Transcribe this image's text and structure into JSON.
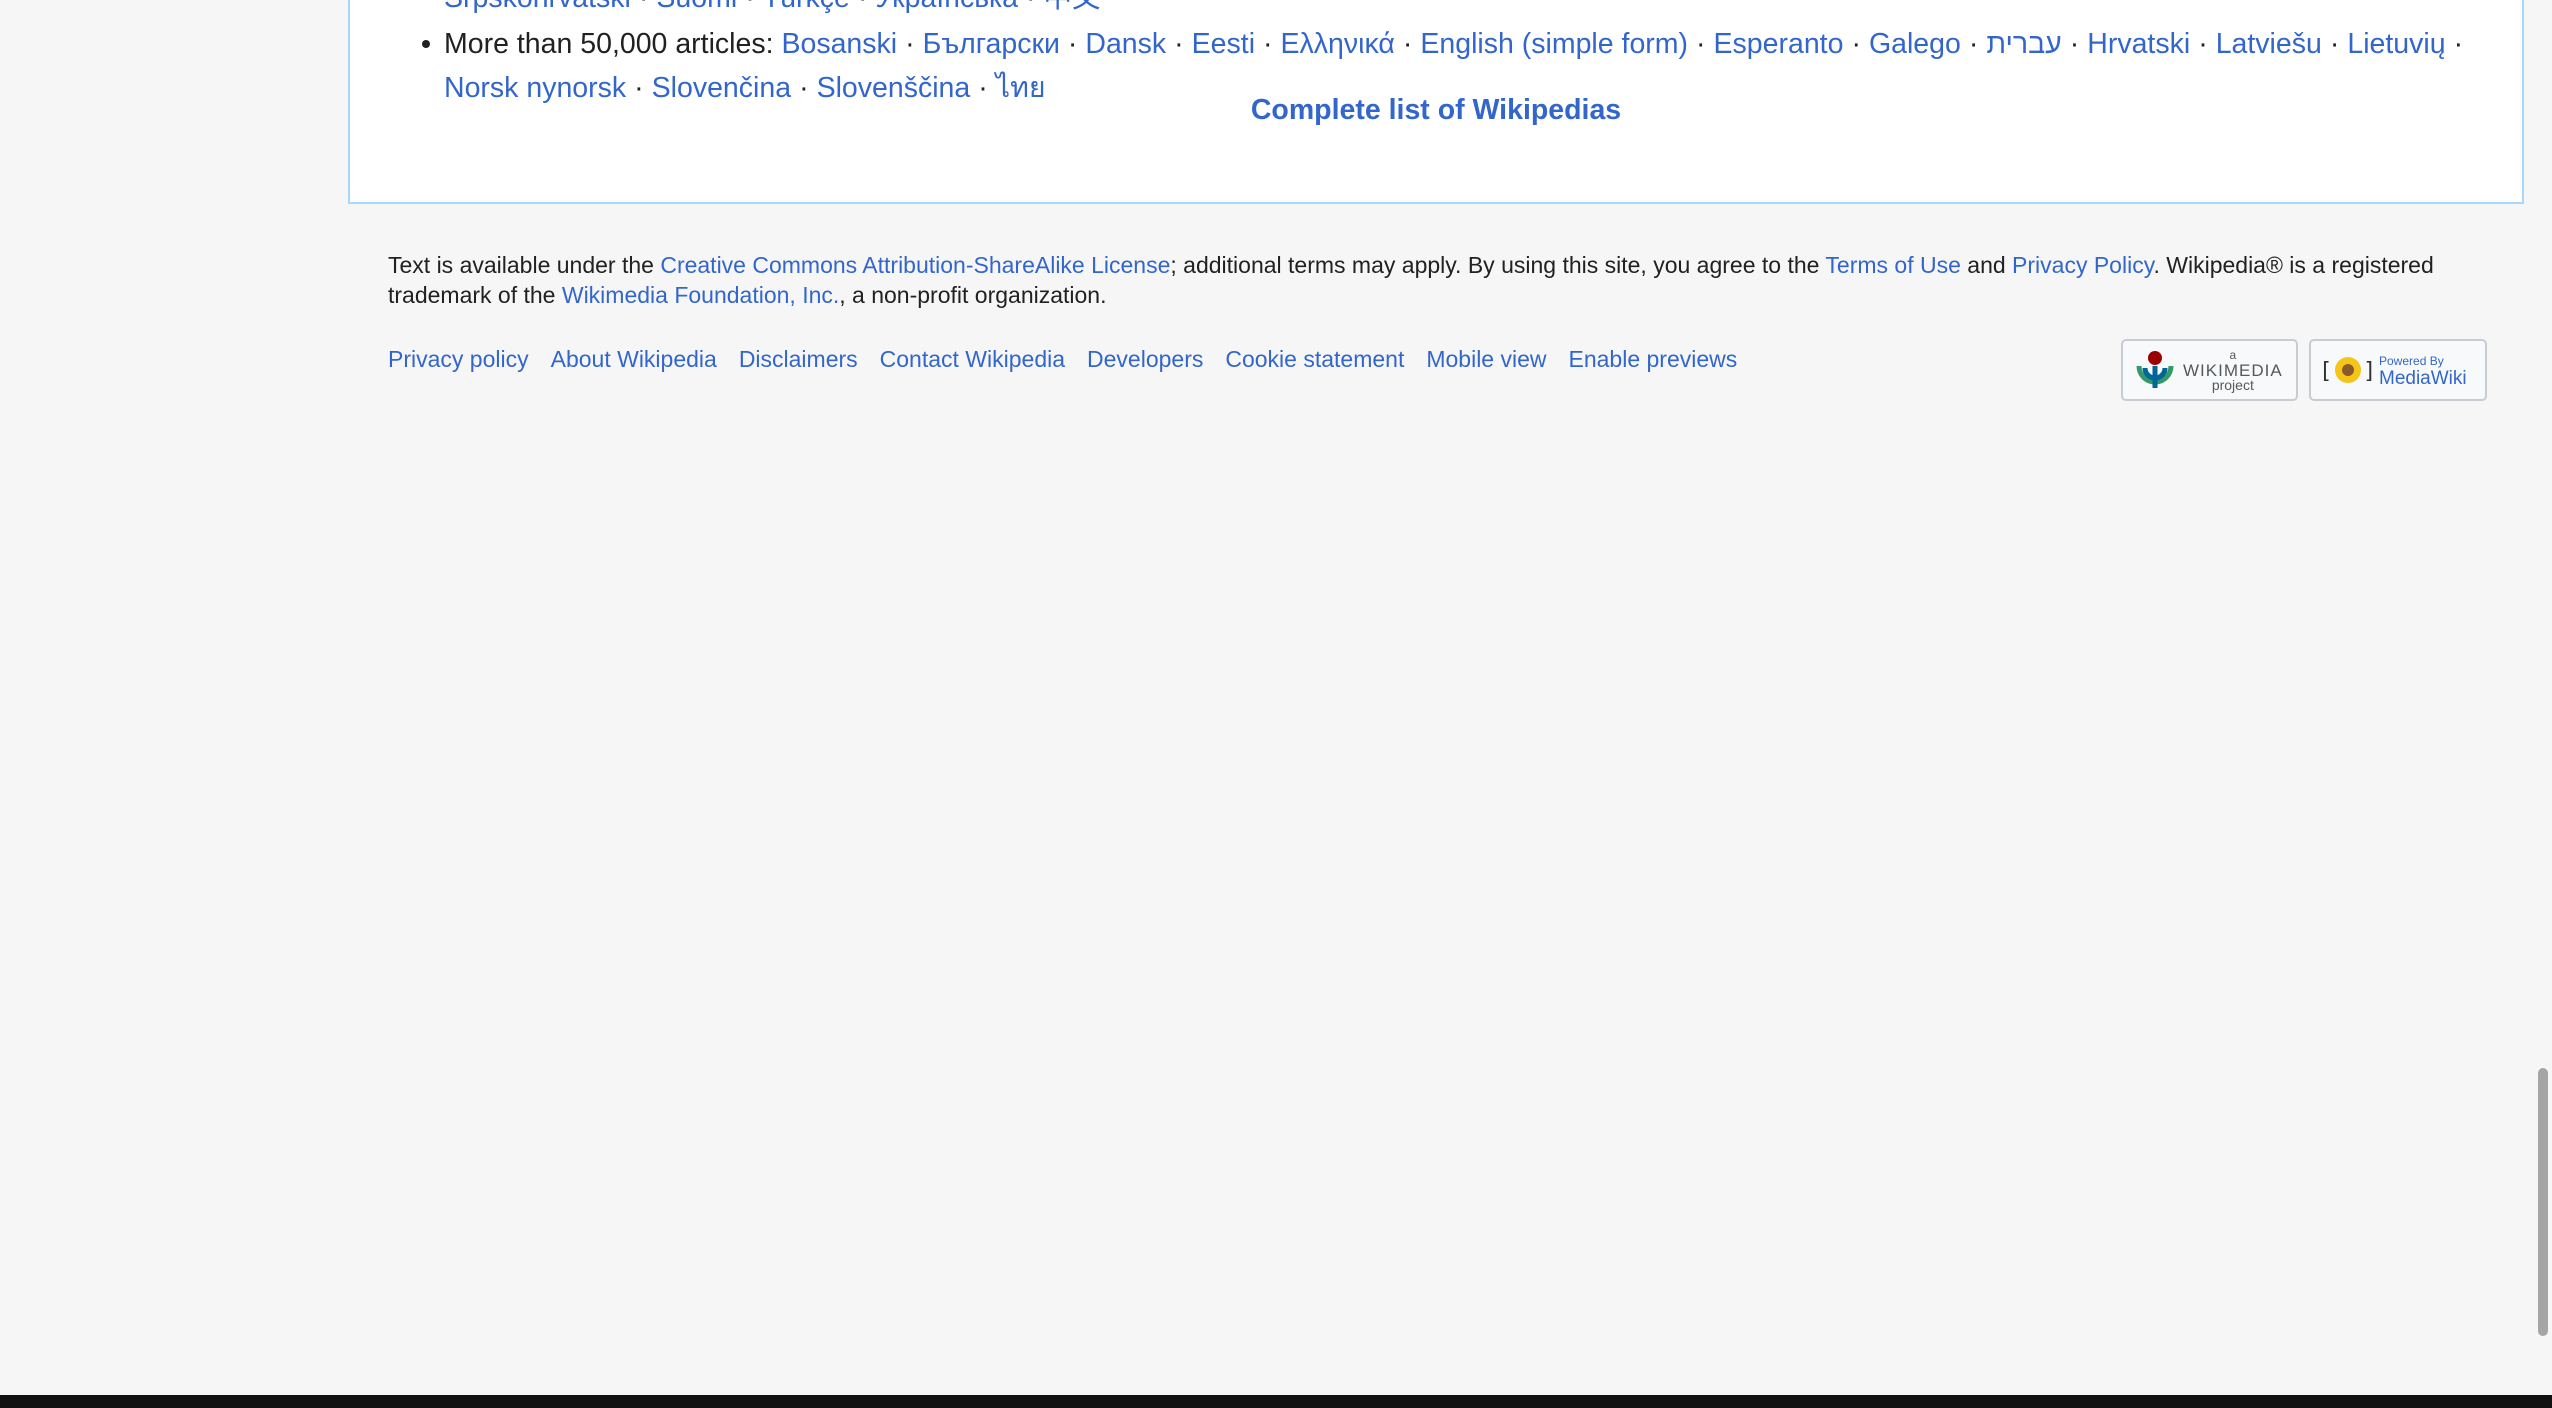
{
  "languages": {
    "row_prev": {
      "items": [
        "Srpskohrvatski",
        "Suomi",
        "Türkçe",
        "Українська",
        "中文"
      ]
    },
    "row_50k": {
      "prefix": "More than 50,000 articles:",
      "line1": [
        "Bosanski",
        "Български",
        "Dansk",
        "Eesti",
        "Ελληνικά",
        "English (simple form)",
        "Esperanto",
        "Galego",
        "עברית",
        "Hrvatski",
        "Latviešu",
        "Lietuvių"
      ],
      "line2": [
        "Norsk nynorsk",
        "Slovenčina",
        "Slovenščina",
        "ไทย"
      ]
    },
    "separator": "·",
    "complete_list": "Complete list of Wikipedias"
  },
  "footer": {
    "license_text_1": "Text is available under the ",
    "license_link": "Creative Commons Attribution-ShareAlike License",
    "license_text_2": "; additional terms may apply. By using this site, you agree to the ",
    "terms_link": "Terms of Use",
    "license_text_3": " and ",
    "privacy_link": "Privacy Policy",
    "license_text_4": ". Wikipedia® is a registered trademark of the ",
    "foundation_link": "Wikimedia Foundation, Inc.",
    "license_text_5": ", a non-profit organization.",
    "places": [
      "Privacy policy",
      "About Wikipedia",
      "Disclaimers",
      "Contact Wikipedia",
      "Developers",
      "Cookie statement",
      "Mobile view",
      "Enable previews"
    ],
    "badges": {
      "wikimedia_top": "a",
      "wikimedia_main": "WIKIMEDIA",
      "wikimedia_sub": "project",
      "mediawiki_top": "Powered By",
      "mediawiki_main": "MediaWiki"
    }
  },
  "colors": {
    "link": "#3366cc",
    "text": "#202122",
    "border": "#a7d7f9",
    "background": "#f6f6f6"
  }
}
